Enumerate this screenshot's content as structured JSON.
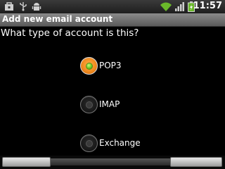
{
  "status_bar": {
    "time": "11:57",
    "left_icons": [
      "bag-icon",
      "usb-icon",
      "android-debug-icon"
    ],
    "right_icons": [
      "wifi-icon",
      "signal-icon",
      "battery-charging-icon"
    ]
  },
  "title": "Add new email account",
  "question": "What type of account is this?",
  "options": [
    {
      "label": "POP3",
      "selected": true
    },
    {
      "label": "IMAP",
      "selected": false
    },
    {
      "label": "Exchange",
      "selected": false
    }
  ],
  "colors": {
    "selected_radio": "#f08a1e",
    "selected_dot": "#66c21e"
  }
}
